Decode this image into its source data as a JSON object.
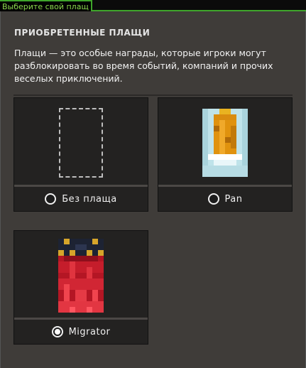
{
  "window": {
    "tab_title": "Выберите свой плащ"
  },
  "section": {
    "heading": "ПРИОБРЕТЕННЫЕ ПЛАЩИ",
    "description": "Плащи — это особые награды, которые игроки могут разблокировать во время событий, компаний и прочих веселых приключений."
  },
  "capes": [
    {
      "label": "Без плаща",
      "selected": false,
      "icon": "empty-cape-slot-icon"
    },
    {
      "label": "Pan",
      "selected": false,
      "icon": "pan-cape-icon"
    },
    {
      "label": "Migrator",
      "selected": true,
      "icon": "migrator-cape-icon"
    }
  ],
  "colors": {
    "accent": "#3fa52b",
    "tab_text": "#8bd94e",
    "panel": "#3f3c39",
    "card": "#232221"
  }
}
